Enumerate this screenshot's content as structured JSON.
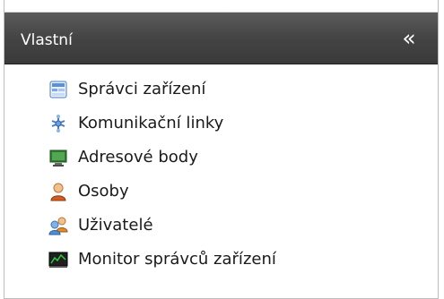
{
  "panel": {
    "title": "Vlastní",
    "collapse_icon": "«"
  },
  "items": [
    {
      "label": "Správci zařízení",
      "icon": "device-manager-icon"
    },
    {
      "label": "Komunikační linky",
      "icon": "network-link-icon"
    },
    {
      "label": "Adresové body",
      "icon": "address-point-icon"
    },
    {
      "label": "Osoby",
      "icon": "person-icon"
    },
    {
      "label": "Uživatelé",
      "icon": "users-icon"
    },
    {
      "label": "Monitor správců zařízení",
      "icon": "monitor-icon"
    }
  ],
  "colors": {
    "header_bg": "#444444",
    "header_text": "#ffffff",
    "item_text": "#1a1a1a"
  }
}
